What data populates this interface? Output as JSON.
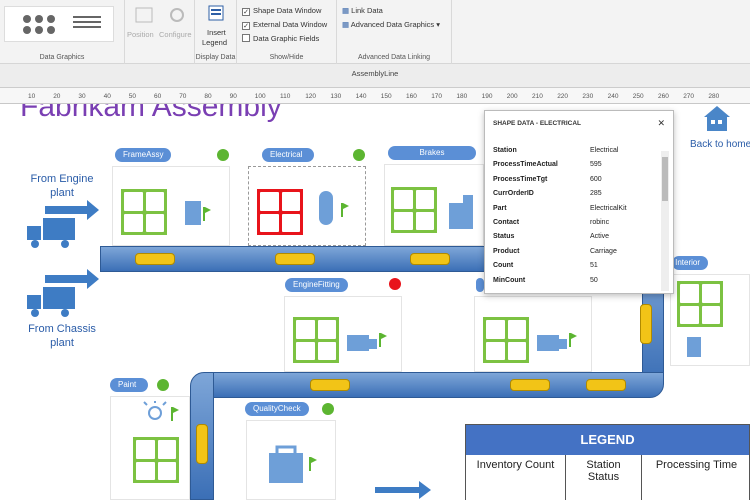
{
  "ribbon": {
    "groups": {
      "data_graphics_label": "Data Graphics",
      "display_data_label": "Display Data",
      "show_hide_label": "Show/Hide",
      "advanced_linking_label": "Advanced Data Linking"
    },
    "buttons": {
      "position": "Position",
      "configure": "Configure",
      "insert_legend_line1": "Insert",
      "insert_legend_line2": "Legend"
    },
    "checkboxes": [
      {
        "label": "Shape Data Window",
        "checked": true
      },
      {
        "label": "External Data Window",
        "checked": true
      },
      {
        "label": "Data Graphic Fields",
        "checked": false
      }
    ],
    "links": {
      "link_data": "Link Data",
      "advanced_data_graphics": "Advanced Data Graphics"
    }
  },
  "document_tab": "AssemblyLine",
  "ruler_ticks": [
    "10",
    "20",
    "30",
    "40",
    "50",
    "60",
    "70",
    "80",
    "90",
    "100",
    "110",
    "120",
    "130",
    "140",
    "150",
    "160",
    "170",
    "180",
    "190",
    "200",
    "210",
    "220",
    "230",
    "240",
    "250",
    "260",
    "270",
    "280"
  ],
  "canvas": {
    "title": "Fabrikam Assembly",
    "back_to_home": "Back to home",
    "from_engine": [
      "From Engine",
      "plant"
    ],
    "from_chassis": [
      "From Chassis",
      "plant"
    ],
    "stations": [
      {
        "name": "FrameAssy",
        "status_color": "#5cb531"
      },
      {
        "name": "Electrical",
        "status_color": "#5cb531"
      },
      {
        "name": "Brakes",
        "status_color": ""
      },
      {
        "name": "EngineFitting",
        "status_color": "#e8141b"
      },
      {
        "name": "Paint",
        "status_color": "#5cb531"
      },
      {
        "name": "QualityCheck",
        "status_color": "#5cb531"
      },
      {
        "name": "Interior",
        "status_color": ""
      }
    ]
  },
  "shape_data": {
    "title": "SHAPE DATA - ELECTRICAL",
    "rows": [
      {
        "key": "Station",
        "value": "Electrical"
      },
      {
        "key": "ProcessTimeActual",
        "value": "595"
      },
      {
        "key": "ProcessTimeTgt",
        "value": "600"
      },
      {
        "key": "CurrOrderID",
        "value": "285"
      },
      {
        "key": "Part",
        "value": "ElectricalKit"
      },
      {
        "key": "Contact",
        "value": "robinc"
      },
      {
        "key": "Status",
        "value": "Active"
      },
      {
        "key": "Product",
        "value": "Carriage"
      },
      {
        "key": "Count",
        "value": "51"
      },
      {
        "key": "MinCount",
        "value": "50"
      }
    ]
  },
  "legend": {
    "title": "LEGEND",
    "columns": [
      "Inventory Count",
      "Station Status",
      "Processing Time"
    ]
  },
  "colors": {
    "accent_blue": "#4472c4",
    "status_green": "#5cb531",
    "status_red": "#e8141b",
    "inventory_green": "#7cc242",
    "inventory_red": "#e8141b",
    "car_yellow": "#f2c417",
    "title_purple": "#7a3fb3"
  }
}
